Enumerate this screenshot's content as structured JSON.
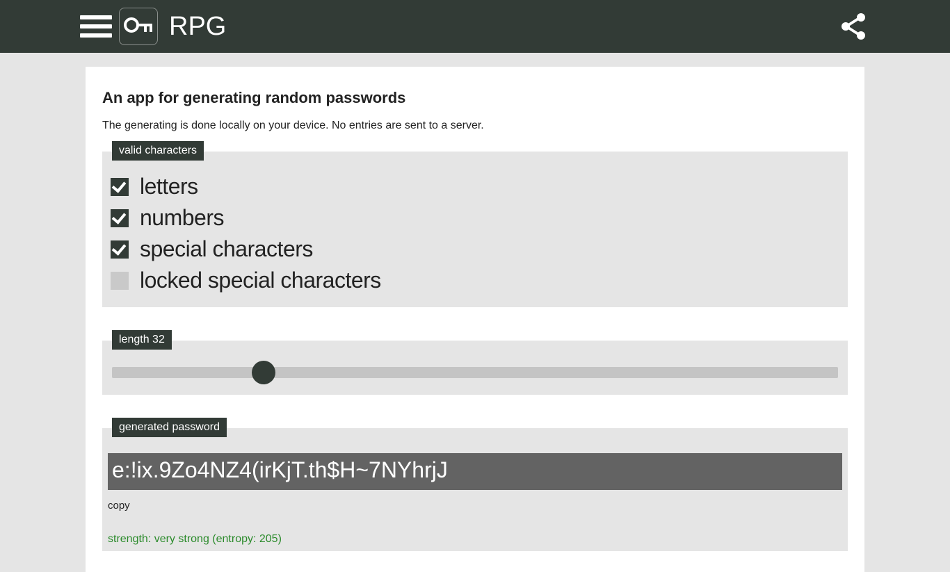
{
  "header": {
    "title": "RPG"
  },
  "main": {
    "heading": "An app for generating random passwords",
    "subheading": "The generating is done locally on your device. No entries are sent to a server."
  },
  "valid_chars": {
    "tag": "valid characters",
    "items": [
      {
        "label": "letters",
        "checked": true
      },
      {
        "label": "numbers",
        "checked": true
      },
      {
        "label": "special characters",
        "checked": true
      },
      {
        "label": "locked special characters",
        "checked": false
      }
    ]
  },
  "length": {
    "tag_prefix": "length ",
    "value": 32,
    "min": 0,
    "max": 160,
    "thumb_percent": 20.9
  },
  "generated": {
    "tag": "generated password",
    "password": "e:!ix.9Zo4NZ4(irKjT.th$H~7NYhrjJ",
    "copy_label": "copy",
    "strength_prefix": "strength: ",
    "strength_text": "very strong",
    "entropy_prefix": " (entropy: ",
    "entropy": 205,
    "entropy_suffix": ")"
  }
}
